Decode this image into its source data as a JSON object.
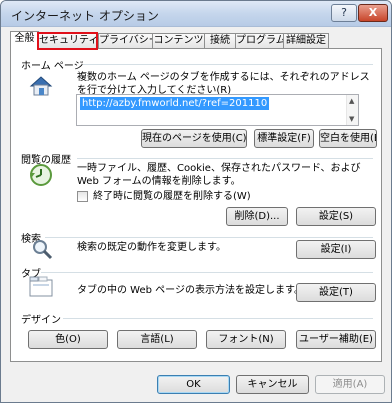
{
  "window": {
    "title": "インターネット オプション",
    "help_glyph": "?",
    "close_glyph": "X"
  },
  "tabs": [
    {
      "label": "全般",
      "active": true
    },
    {
      "label": "セキュリティ",
      "highlighted": true,
      "highlight_color": "#e0101a"
    },
    {
      "label": "プライバシー"
    },
    {
      "label": "コンテンツ"
    },
    {
      "label": "接続"
    },
    {
      "label": "プログラム"
    },
    {
      "label": "詳細設定"
    }
  ],
  "home_page": {
    "label": "ホーム ページ",
    "description": "複数のホーム ページのタブを作成するには、それぞれのアドレスを行で分けて入力してください(R)",
    "url": "http://azby.fmworld.net/?ref=201110",
    "buttons": {
      "use_current": "現在のページを使用(C)",
      "use_default": "標準設定(F)",
      "use_blank": "空白を使用(B)"
    },
    "icon": "house-icon"
  },
  "history": {
    "label": "閲覧の履歴",
    "description": "一時ファイル、履歴、Cookie、保存されたパスワード、および Web フォームの情報を削除します。",
    "checkbox_label": "終了時に閲覧の履歴を削除する(W)",
    "checkbox_checked": false,
    "buttons": {
      "delete": "削除(D)...",
      "settings": "設定(S)"
    },
    "icon": "history-clock-icon"
  },
  "search": {
    "label": "検索",
    "description": "検索の既定の動作を変更します。",
    "settings_button": "設定(I)",
    "icon": "magnifier-icon"
  },
  "tabs_section": {
    "label": "タブ",
    "description": "タブの中の Web ページの表示方法を設定します。",
    "settings_button": "設定(T)",
    "icon": "tabbed-window-icon"
  },
  "design": {
    "label": "デザイン",
    "buttons": {
      "colors": "色(O)",
      "languages": "言語(L)",
      "fonts": "フォント(N)",
      "accessibility": "ユーザー補助(E)"
    }
  },
  "footer": {
    "ok": "OK",
    "cancel": "キャンセル",
    "apply": "適用(A)",
    "apply_disabled": true
  }
}
